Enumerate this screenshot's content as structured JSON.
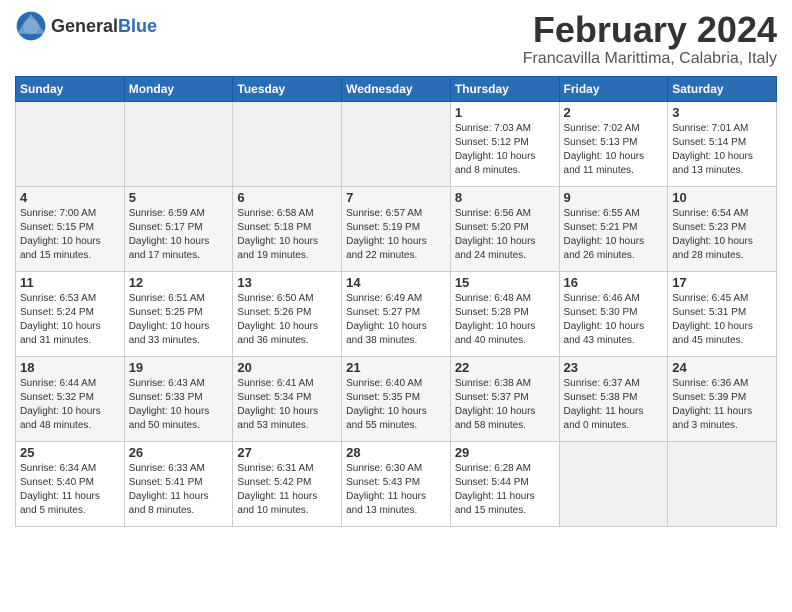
{
  "header": {
    "logo_general": "General",
    "logo_blue": "Blue",
    "month_title": "February 2024",
    "location": "Francavilla Marittima, Calabria, Italy"
  },
  "days_of_week": [
    "Sunday",
    "Monday",
    "Tuesday",
    "Wednesday",
    "Thursday",
    "Friday",
    "Saturday"
  ],
  "weeks": [
    [
      {
        "day": "",
        "info": ""
      },
      {
        "day": "",
        "info": ""
      },
      {
        "day": "",
        "info": ""
      },
      {
        "day": "",
        "info": ""
      },
      {
        "day": "1",
        "info": "Sunrise: 7:03 AM\nSunset: 5:12 PM\nDaylight: 10 hours\nand 8 minutes."
      },
      {
        "day": "2",
        "info": "Sunrise: 7:02 AM\nSunset: 5:13 PM\nDaylight: 10 hours\nand 11 minutes."
      },
      {
        "day": "3",
        "info": "Sunrise: 7:01 AM\nSunset: 5:14 PM\nDaylight: 10 hours\nand 13 minutes."
      }
    ],
    [
      {
        "day": "4",
        "info": "Sunrise: 7:00 AM\nSunset: 5:15 PM\nDaylight: 10 hours\nand 15 minutes."
      },
      {
        "day": "5",
        "info": "Sunrise: 6:59 AM\nSunset: 5:17 PM\nDaylight: 10 hours\nand 17 minutes."
      },
      {
        "day": "6",
        "info": "Sunrise: 6:58 AM\nSunset: 5:18 PM\nDaylight: 10 hours\nand 19 minutes."
      },
      {
        "day": "7",
        "info": "Sunrise: 6:57 AM\nSunset: 5:19 PM\nDaylight: 10 hours\nand 22 minutes."
      },
      {
        "day": "8",
        "info": "Sunrise: 6:56 AM\nSunset: 5:20 PM\nDaylight: 10 hours\nand 24 minutes."
      },
      {
        "day": "9",
        "info": "Sunrise: 6:55 AM\nSunset: 5:21 PM\nDaylight: 10 hours\nand 26 minutes."
      },
      {
        "day": "10",
        "info": "Sunrise: 6:54 AM\nSunset: 5:23 PM\nDaylight: 10 hours\nand 28 minutes."
      }
    ],
    [
      {
        "day": "11",
        "info": "Sunrise: 6:53 AM\nSunset: 5:24 PM\nDaylight: 10 hours\nand 31 minutes."
      },
      {
        "day": "12",
        "info": "Sunrise: 6:51 AM\nSunset: 5:25 PM\nDaylight: 10 hours\nand 33 minutes."
      },
      {
        "day": "13",
        "info": "Sunrise: 6:50 AM\nSunset: 5:26 PM\nDaylight: 10 hours\nand 36 minutes."
      },
      {
        "day": "14",
        "info": "Sunrise: 6:49 AM\nSunset: 5:27 PM\nDaylight: 10 hours\nand 38 minutes."
      },
      {
        "day": "15",
        "info": "Sunrise: 6:48 AM\nSunset: 5:28 PM\nDaylight: 10 hours\nand 40 minutes."
      },
      {
        "day": "16",
        "info": "Sunrise: 6:46 AM\nSunset: 5:30 PM\nDaylight: 10 hours\nand 43 minutes."
      },
      {
        "day": "17",
        "info": "Sunrise: 6:45 AM\nSunset: 5:31 PM\nDaylight: 10 hours\nand 45 minutes."
      }
    ],
    [
      {
        "day": "18",
        "info": "Sunrise: 6:44 AM\nSunset: 5:32 PM\nDaylight: 10 hours\nand 48 minutes."
      },
      {
        "day": "19",
        "info": "Sunrise: 6:43 AM\nSunset: 5:33 PM\nDaylight: 10 hours\nand 50 minutes."
      },
      {
        "day": "20",
        "info": "Sunrise: 6:41 AM\nSunset: 5:34 PM\nDaylight: 10 hours\nand 53 minutes."
      },
      {
        "day": "21",
        "info": "Sunrise: 6:40 AM\nSunset: 5:35 PM\nDaylight: 10 hours\nand 55 minutes."
      },
      {
        "day": "22",
        "info": "Sunrise: 6:38 AM\nSunset: 5:37 PM\nDaylight: 10 hours\nand 58 minutes."
      },
      {
        "day": "23",
        "info": "Sunrise: 6:37 AM\nSunset: 5:38 PM\nDaylight: 11 hours\nand 0 minutes."
      },
      {
        "day": "24",
        "info": "Sunrise: 6:36 AM\nSunset: 5:39 PM\nDaylight: 11 hours\nand 3 minutes."
      }
    ],
    [
      {
        "day": "25",
        "info": "Sunrise: 6:34 AM\nSunset: 5:40 PM\nDaylight: 11 hours\nand 5 minutes."
      },
      {
        "day": "26",
        "info": "Sunrise: 6:33 AM\nSunset: 5:41 PM\nDaylight: 11 hours\nand 8 minutes."
      },
      {
        "day": "27",
        "info": "Sunrise: 6:31 AM\nSunset: 5:42 PM\nDaylight: 11 hours\nand 10 minutes."
      },
      {
        "day": "28",
        "info": "Sunrise: 6:30 AM\nSunset: 5:43 PM\nDaylight: 11 hours\nand 13 minutes."
      },
      {
        "day": "29",
        "info": "Sunrise: 6:28 AM\nSunset: 5:44 PM\nDaylight: 11 hours\nand 15 minutes."
      },
      {
        "day": "",
        "info": ""
      },
      {
        "day": "",
        "info": ""
      }
    ]
  ]
}
